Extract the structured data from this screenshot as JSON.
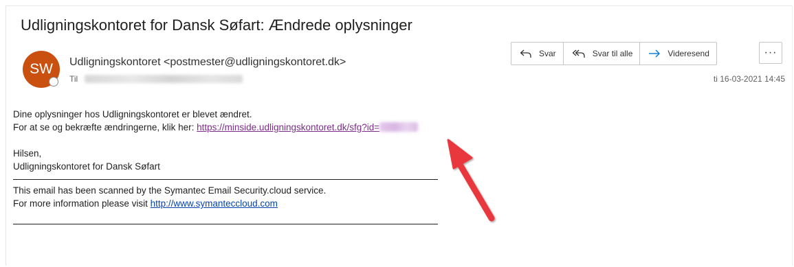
{
  "subject": "Udligningskontoret for Dansk Søfart: Ændrede oplysninger",
  "sender": {
    "initials": "SW",
    "display": "Udligningskontoret <postmester@udligningskontoret.dk>",
    "avatar_color": "#ca5010"
  },
  "to_label": "Til",
  "actions": {
    "reply": "Svar",
    "reply_all": "Svar til alle",
    "forward": "Videresend",
    "more": "···"
  },
  "date": "ti 16-03-2021 14:45",
  "body": {
    "line1": "Dine oplysninger hos Udligningskontoret er blevet ændret.",
    "line2_prefix": "For at se og bekræfte ændringerne, klik her: ",
    "line2_link": "https://minside.udligningskontoret.dk/sfg?id=",
    "greeting": "Hilsen,",
    "signature": "Udligningskontoret for Dansk Søfart",
    "scan_line1": "This email has been scanned by the Symantec Email Security.cloud service.",
    "scan_line2_prefix": "For more information please visit ",
    "scan_link": "http://www.symanteccloud.com"
  },
  "colors": {
    "annotation_arrow": "#e8383d",
    "link_visited": "#7b2b88",
    "link": "#0645ad"
  }
}
